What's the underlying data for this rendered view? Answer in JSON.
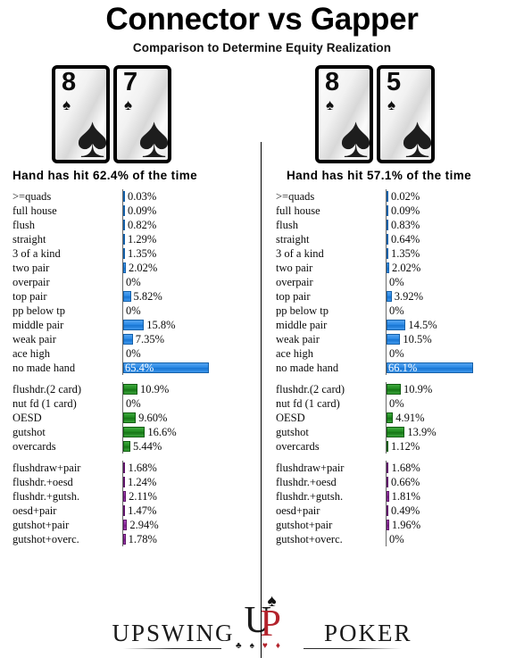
{
  "header": {
    "title": "Connector vs Gapper",
    "subtitle": "Comparison to Determine Equity Realization"
  },
  "panels": [
    {
      "side": "left",
      "hand_name": "connector",
      "cards": [
        {
          "rank": "8",
          "suit": "♠",
          "suit_name": "spade"
        },
        {
          "rank": "7",
          "suit": "♠",
          "suit_name": "spade"
        }
      ],
      "hit_line": "Hand has hit 62.4% of the time",
      "hit_percent": 62.4,
      "sections": [
        {
          "name": "made-hands",
          "color": "#1874d2",
          "rows": [
            {
              "label": ">=quads",
              "value": "0.03%",
              "num": 0.03
            },
            {
              "label": "full house",
              "value": "0.09%",
              "num": 0.09
            },
            {
              "label": "flush",
              "value": "0.82%",
              "num": 0.82
            },
            {
              "label": "straight",
              "value": "1.29%",
              "num": 1.29
            },
            {
              "label": "3 of a kind",
              "value": "1.35%",
              "num": 1.35
            },
            {
              "label": "two pair",
              "value": "2.02%",
              "num": 2.02
            },
            {
              "label": "overpair",
              "value": "0%",
              "num": 0
            },
            {
              "label": "top pair",
              "value": "5.82%",
              "num": 5.82
            },
            {
              "label": "pp below tp",
              "value": "0%",
              "num": 0
            },
            {
              "label": "middle pair",
              "value": "15.8%",
              "num": 15.8
            },
            {
              "label": "weak pair",
              "value": "7.35%",
              "num": 7.35
            },
            {
              "label": "ace high",
              "value": "0%",
              "num": 0
            },
            {
              "label": "no made hand",
              "value": "65.4%",
              "num": 65.4
            }
          ]
        },
        {
          "name": "draws",
          "color": "#157415",
          "rows": [
            {
              "label": "flushdr.(2 card)",
              "value": "10.9%",
              "num": 10.9
            },
            {
              "label": "nut fd (1 card)",
              "value": "0%",
              "num": 0
            },
            {
              "label": "OESD",
              "value": "9.60%",
              "num": 9.6
            },
            {
              "label": "gutshot",
              "value": "16.6%",
              "num": 16.6
            },
            {
              "label": "overcards",
              "value": "5.44%",
              "num": 5.44
            }
          ]
        },
        {
          "name": "combo-draws",
          "color": "#7a1d8c",
          "rows": [
            {
              "label": "flushdraw+pair",
              "value": "1.68%",
              "num": 1.68
            },
            {
              "label": "flushdr.+oesd",
              "value": "1.24%",
              "num": 1.24
            },
            {
              "label": "flushdr.+gutsh.",
              "value": "2.11%",
              "num": 2.11
            },
            {
              "label": "oesd+pair",
              "value": "1.47%",
              "num": 1.47
            },
            {
              "label": "gutshot+pair",
              "value": "2.94%",
              "num": 2.94
            },
            {
              "label": "gutshot+overc.",
              "value": "1.78%",
              "num": 1.78
            }
          ]
        }
      ]
    },
    {
      "side": "right",
      "hand_name": "gapper",
      "cards": [
        {
          "rank": "8",
          "suit": "♠",
          "suit_name": "spade"
        },
        {
          "rank": "5",
          "suit": "♠",
          "suit_name": "spade"
        }
      ],
      "hit_line": "Hand has hit 57.1% of the time",
      "hit_percent": 57.1,
      "sections": [
        {
          "name": "made-hands",
          "color": "#1874d2",
          "rows": [
            {
              "label": ">=quads",
              "value": "0.02%",
              "num": 0.02
            },
            {
              "label": "full house",
              "value": "0.09%",
              "num": 0.09
            },
            {
              "label": "flush",
              "value": "0.83%",
              "num": 0.83
            },
            {
              "label": "straight",
              "value": "0.64%",
              "num": 0.64
            },
            {
              "label": "3 of a kind",
              "value": "1.35%",
              "num": 1.35
            },
            {
              "label": "two pair",
              "value": "2.02%",
              "num": 2.02
            },
            {
              "label": "overpair",
              "value": "0%",
              "num": 0
            },
            {
              "label": "top pair",
              "value": "3.92%",
              "num": 3.92
            },
            {
              "label": "pp below tp",
              "value": "0%",
              "num": 0
            },
            {
              "label": "middle pair",
              "value": "14.5%",
              "num": 14.5
            },
            {
              "label": "weak pair",
              "value": "10.5%",
              "num": 10.5
            },
            {
              "label": "ace high",
              "value": "0%",
              "num": 0
            },
            {
              "label": "no made hand",
              "value": "66.1%",
              "num": 66.1
            }
          ]
        },
        {
          "name": "draws",
          "color": "#157415",
          "rows": [
            {
              "label": "flushdr.(2 card)",
              "value": "10.9%",
              "num": 10.9
            },
            {
              "label": "nut fd (1 card)",
              "value": "0%",
              "num": 0
            },
            {
              "label": "OESD",
              "value": "4.91%",
              "num": 4.91
            },
            {
              "label": "gutshot",
              "value": "13.9%",
              "num": 13.9
            },
            {
              "label": "overcards",
              "value": "1.12%",
              "num": 1.12
            }
          ]
        },
        {
          "name": "combo-draws",
          "color": "#7a1d8c",
          "rows": [
            {
              "label": "flushdraw+pair",
              "value": "1.68%",
              "num": 1.68
            },
            {
              "label": "flushdr.+oesd",
              "value": "0.66%",
              "num": 0.66
            },
            {
              "label": "flushdr.+gutsh.",
              "value": "1.81%",
              "num": 1.81
            },
            {
              "label": "oesd+pair",
              "value": "0.49%",
              "num": 0.49
            },
            {
              "label": "gutshot+pair",
              "value": "1.96%",
              "num": 1.96
            },
            {
              "label": "gutshot+overc.",
              "value": "0%",
              "num": 0
            }
          ]
        }
      ]
    }
  ],
  "footer": {
    "brand_left": "UPSWING",
    "brand_right": "POKER",
    "monogram_u": "U",
    "monogram_p": "P",
    "monogram_spade": "♠",
    "suit_row": [
      "♣",
      "♠",
      "♥",
      "♦"
    ]
  },
  "chart_data": {
    "type": "bar",
    "title": "Connector vs Gapper",
    "subtitle": "Comparison to Determine Equity Realization",
    "xlabel": "",
    "ylabel": "",
    "xlim": [
      0,
      70
    ],
    "grid": false,
    "legend": "none",
    "orientation": "horizontal",
    "pixels_per_percent": 1.47,
    "categories": [
      ">=quads",
      "full house",
      "flush",
      "straight",
      "3 of a kind",
      "two pair",
      "overpair",
      "top pair",
      "pp below tp",
      "middle pair",
      "weak pair",
      "ace high",
      "no made hand",
      "flushdr.(2 card)",
      "nut fd (1 card)",
      "OESD",
      "gutshot",
      "overcards",
      "flushdraw+pair",
      "flushdr.+oesd",
      "flushdr.+gutsh.",
      "oesd+pair",
      "gutshot+pair",
      "gutshot+overc."
    ],
    "series": [
      {
        "name": "8s7s (connector) - hit 62.4%",
        "values": [
          0.03,
          0.09,
          0.82,
          1.29,
          1.35,
          2.02,
          0,
          5.82,
          0,
          15.8,
          7.35,
          0,
          65.4,
          10.9,
          0,
          9.6,
          16.6,
          5.44,
          1.68,
          1.24,
          2.11,
          1.47,
          2.94,
          1.78
        ]
      },
      {
        "name": "8s5s (gapper) - hit 57.1%",
        "values": [
          0.02,
          0.09,
          0.83,
          0.64,
          1.35,
          2.02,
          0,
          3.92,
          0,
          14.5,
          10.5,
          0,
          66.1,
          10.9,
          0,
          4.91,
          13.9,
          1.12,
          1.68,
          0.66,
          1.81,
          0.49,
          1.96,
          0
        ]
      }
    ],
    "annotations": [
      "Hand has hit 62.4% of the time",
      "Hand has hit 57.1% of the time"
    ]
  }
}
